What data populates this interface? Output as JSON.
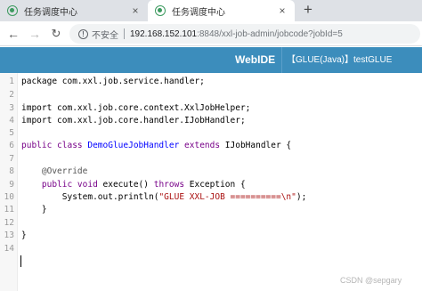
{
  "browser": {
    "tabs": [
      {
        "title": "任务调度中心",
        "active": false
      },
      {
        "title": "任务调度中心",
        "active": true
      }
    ],
    "new_tab": "+",
    "close_glyph": "×",
    "address": {
      "security_label": "不安全",
      "host": "192.168.152.101",
      "path": ":8848/xxl-job-admin/jobcode?jobId=5"
    }
  },
  "ide": {
    "brand": "WebIDE",
    "glue_label": "【GLUE(Java)】testGLUE",
    "colors": {
      "header": "#3c8dbc",
      "keyword": "#770088",
      "definition": "#0000ff",
      "string": "#aa1111"
    }
  },
  "editor": {
    "lines": [
      {
        "n": "1",
        "tokens": [
          {
            "t": "package com.xxl.job.service.handler;",
            "c": "plain"
          }
        ]
      },
      {
        "n": "2",
        "tokens": []
      },
      {
        "n": "3",
        "tokens": [
          {
            "t": "import com.xxl.job.core.context.XxlJobHelper;",
            "c": "plain"
          }
        ]
      },
      {
        "n": "4",
        "tokens": [
          {
            "t": "import com.xxl.job.core.handler.IJobHandler;",
            "c": "plain"
          }
        ]
      },
      {
        "n": "5",
        "tokens": []
      },
      {
        "n": "6",
        "tokens": [
          {
            "t": "public class ",
            "c": "kw"
          },
          {
            "t": "DemoGlueJobHandler",
            "c": "def"
          },
          {
            "t": " extends ",
            "c": "kw"
          },
          {
            "t": "IJobHandler {",
            "c": "plain"
          }
        ]
      },
      {
        "n": "7",
        "tokens": []
      },
      {
        "n": "8",
        "tokens": [
          {
            "t": "    @Override",
            "c": "meta"
          }
        ]
      },
      {
        "n": "9",
        "tokens": [
          {
            "t": "    public void ",
            "c": "kw"
          },
          {
            "t": "execute() ",
            "c": "plain"
          },
          {
            "t": "throws ",
            "c": "kw"
          },
          {
            "t": "Exception {",
            "c": "plain"
          }
        ]
      },
      {
        "n": "10",
        "tokens": [
          {
            "t": "        System.out.println(",
            "c": "plain"
          },
          {
            "t": "\"GLUE XXL-JOB ==========\\n\"",
            "c": "str"
          },
          {
            "t": ");",
            "c": "plain"
          }
        ]
      },
      {
        "n": "11",
        "tokens": [
          {
            "t": "    }",
            "c": "plain"
          }
        ]
      },
      {
        "n": "12",
        "tokens": []
      },
      {
        "n": "13",
        "tokens": [
          {
            "t": "}",
            "c": "plain"
          }
        ]
      },
      {
        "n": "14",
        "tokens": []
      }
    ]
  },
  "watermark": "CSDN @sepgary"
}
